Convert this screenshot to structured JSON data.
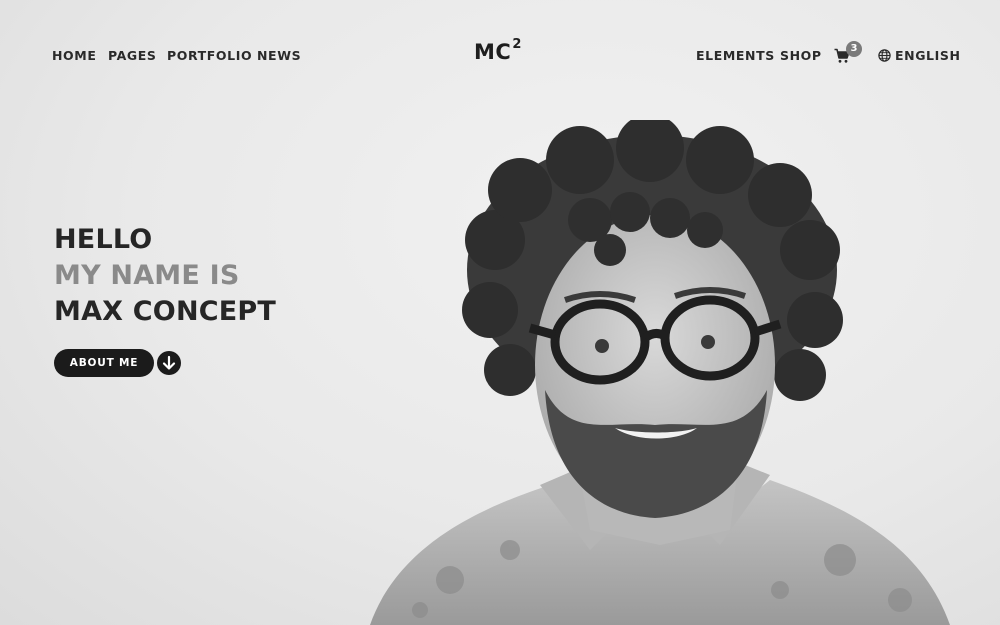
{
  "nav": {
    "left": [
      "HOME",
      "PAGES",
      "PORTFOLIO",
      "NEWS"
    ],
    "logo": "MC",
    "logo_sup": "2",
    "right": [
      "ELEMENTS",
      "SHOP"
    ],
    "cart_count": "3",
    "language": "ENGLISH"
  },
  "hero": {
    "line1": "HELLO",
    "line2": "MY NAME IS",
    "line3": "MAX CONCEPT",
    "button": "ABOUT ME"
  },
  "icons": [
    "shopping-cart-icon",
    "globe-icon",
    "arrow-down-icon"
  ],
  "colors": {
    "background": "#e9e9e9",
    "text": "#262626",
    "muted": "#8a8a8a",
    "button": "#1b1b1b"
  }
}
